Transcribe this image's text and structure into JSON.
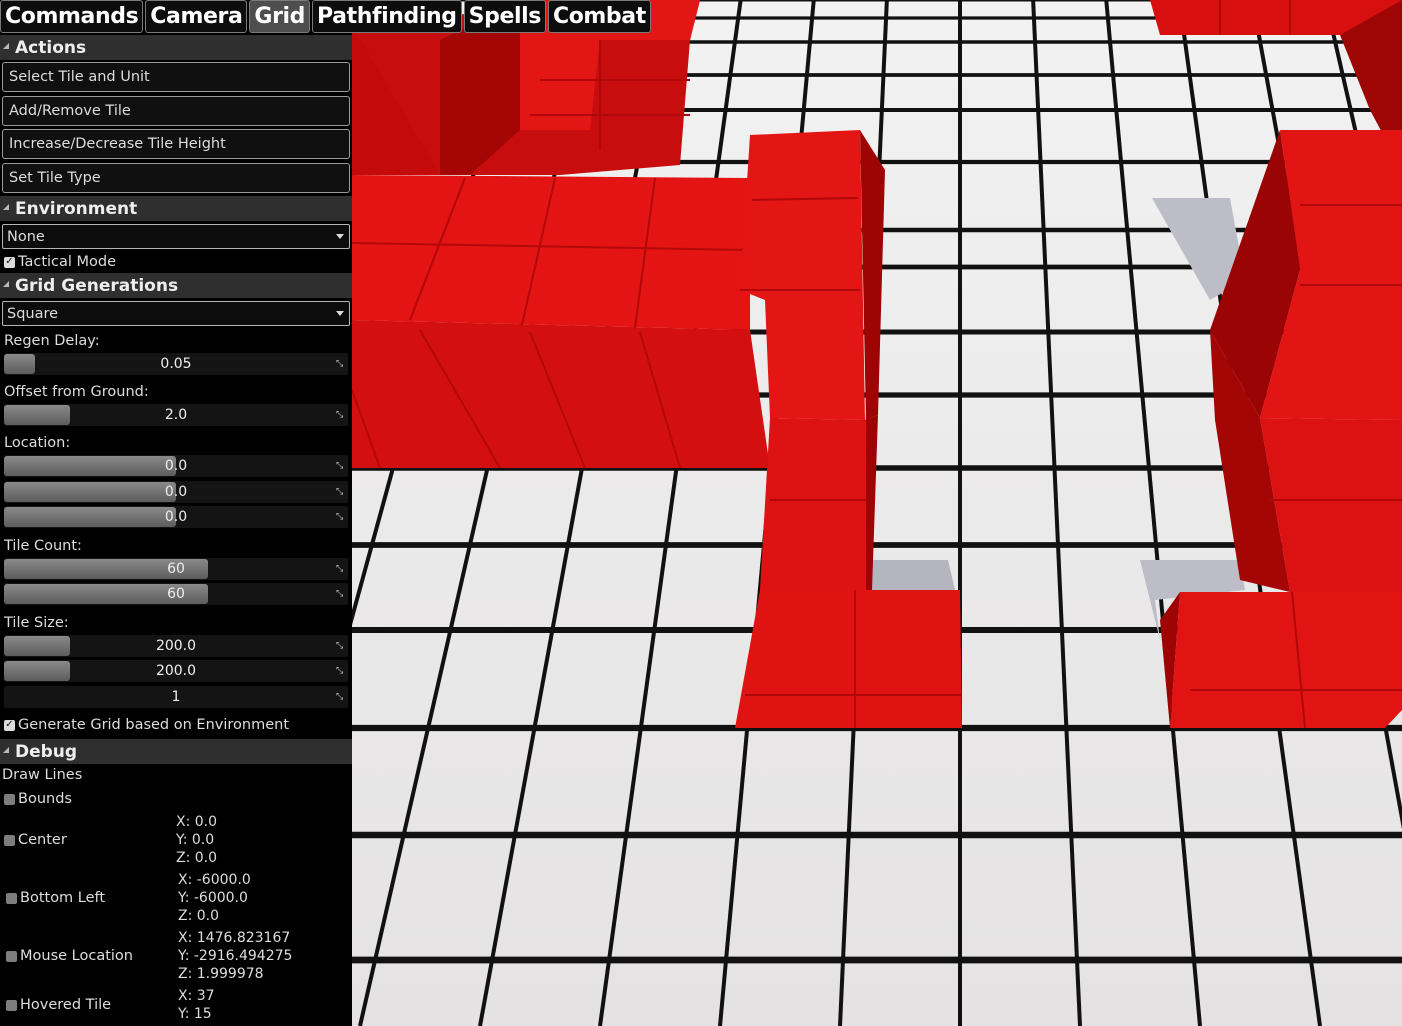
{
  "tabs": [
    "Commands",
    "Camera",
    "Grid",
    "Pathfinding",
    "Spells",
    "Combat"
  ],
  "active_tab": "Grid",
  "colors": {
    "panel_bg": "#000000",
    "header_bg": "#2f2f2f",
    "tile": "#e8e8e8",
    "grid_line": "#111111",
    "wall": "#d81010"
  },
  "actions": {
    "title": "Actions",
    "buttons": [
      "Select Tile and Unit",
      "Add/Remove Tile",
      "Increase/Decrease Tile Height",
      "Set Tile Type"
    ]
  },
  "environment": {
    "title": "Environment",
    "selected": "None",
    "tactical_mode_label": "Tactical Mode",
    "tactical_mode_checked": true
  },
  "grid_gen": {
    "title": "Grid Generations",
    "shape": "Square",
    "regen_delay_label": "Regen Delay:",
    "regen_delay": "0.05",
    "offset_label": "Offset from Ground:",
    "offset": "2.0",
    "location_label": "Location:",
    "location": [
      "0.0",
      "0.0",
      "0.0"
    ],
    "tile_count_label": "Tile Count:",
    "tile_count": [
      "60",
      "60"
    ],
    "tile_size_label": "Tile Size:",
    "tile_size": [
      "200.0",
      "200.0",
      "1"
    ],
    "env_based_label": "Generate Grid based on Environment",
    "env_based_checked": true
  },
  "debug": {
    "title": "Debug",
    "draw_lines_label": "Draw Lines",
    "bounds_label": "Bounds",
    "center_label": "Center",
    "center": [
      "X: 0.0",
      "Y: 0.0",
      "Z: 0.0"
    ],
    "bottom_left_label": "Bottom Left",
    "bottom_left": [
      "X: -6000.0",
      "Y: -6000.0",
      "Z: 0.0"
    ],
    "mouse_location_label": "Mouse Location",
    "mouse_location": [
      "X: 1476.823167",
      "Y: -2916.494275",
      "Z: 1.999978"
    ],
    "hovered_tile_label": "Hovered Tile",
    "hovered_tile": [
      "X: 37",
      "Y: 15"
    ]
  },
  "icons": {
    "expand": "triangle-icon",
    "dropdown": "caret-down-icon",
    "slider": "resize-grip-icon",
    "check": "checkmark-icon"
  }
}
